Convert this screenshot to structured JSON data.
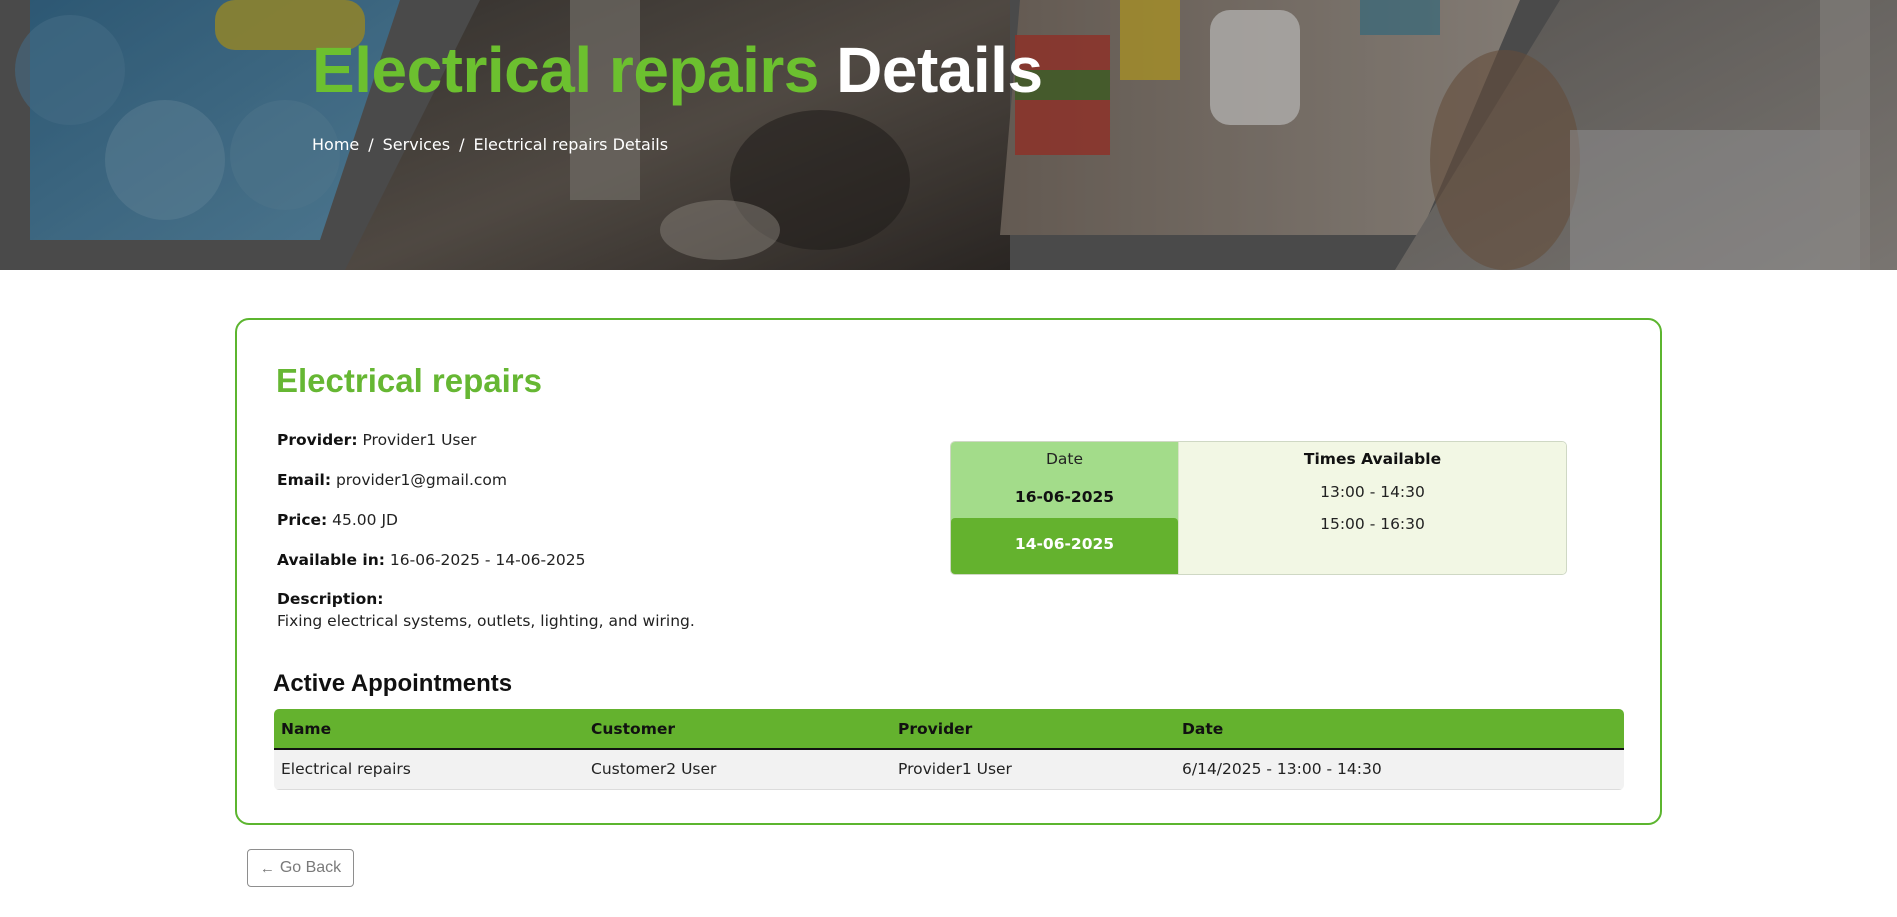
{
  "hero": {
    "title_highlight": "Electrical repairs",
    "title_rest": "Details",
    "breadcrumb": {
      "home": "Home",
      "services": "Services",
      "current": "Electrical repairs Details",
      "separator": "/"
    }
  },
  "service": {
    "title": "Electrical repairs",
    "provider_label": "Provider:",
    "provider": "Provider1 User",
    "email_label": "Email:",
    "email": "provider1@gmail.com",
    "price_label": "Price:",
    "price": "45.00 JD",
    "available_label": "Available in:",
    "available": "16-06-2025 - 14-06-2025",
    "description_label": "Description:",
    "description": "Fixing electrical systems, outlets, lighting, and wiring."
  },
  "slots": {
    "date_header": "Date",
    "times_header": "Times Available",
    "dates": [
      "16-06-2025",
      "14-06-2025"
    ],
    "selected_date": "14-06-2025",
    "times": [
      "13:00 - 14:30",
      "15:00 - 16:30"
    ]
  },
  "appointments": {
    "title": "Active Appointments",
    "columns": [
      "Name",
      "Customer",
      "Provider",
      "Date"
    ],
    "rows": [
      [
        "Electrical repairs",
        "Customer2 User",
        "Provider1 User",
        "6/14/2025 - 13:00 - 14:30"
      ]
    ]
  },
  "go_back": {
    "arrow": "←",
    "label": "Go Back"
  },
  "colors": {
    "accent": "#64b22e",
    "title_green": "#66b733",
    "date_column": "#a3dc8a",
    "times_column": "#f2f7e4",
    "row_bg": "#f2f2f2"
  },
  "icons": [
    "left-arrow-icon"
  ]
}
